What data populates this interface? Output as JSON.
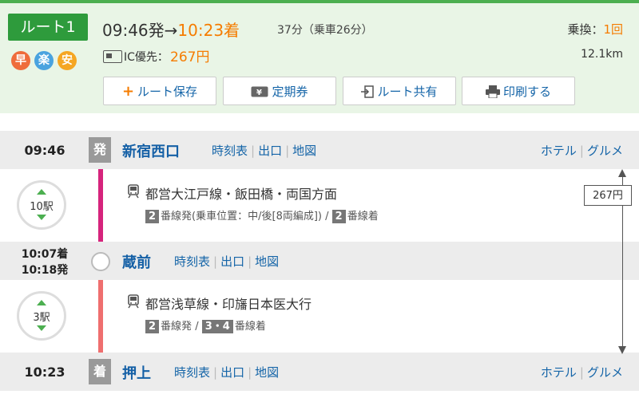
{
  "route": {
    "badge": "ルート1",
    "tags": [
      {
        "label": "早",
        "color": "#ef6c3c"
      },
      {
        "label": "楽",
        "color": "#4aa3df"
      },
      {
        "label": "安",
        "color": "#f5a623"
      }
    ],
    "depart": "09:46発",
    "arrow": "→",
    "arrive": "10:23着",
    "duration": "37分（乗車26分）",
    "transfer_label": "乗換：",
    "transfer_count": "1回",
    "fare_label": "IC優先：",
    "fare_value": "267円",
    "distance": "12.1km"
  },
  "buttons": {
    "save": "ルート保存",
    "pass": "定期券",
    "share": "ルート共有",
    "print": "印刷する"
  },
  "stations": [
    {
      "time": "09:46",
      "badge": "発",
      "name": "新宿西口",
      "links": [
        "時刻表",
        "出口",
        "地図"
      ],
      "extras": [
        "ホテル",
        "グルメ"
      ]
    },
    {
      "time_arr": "10:07着",
      "time_dep": "10:18発",
      "name": "蔵前",
      "links": [
        "時刻表",
        "出口",
        "地図"
      ]
    },
    {
      "time": "10:23",
      "badge": "着",
      "name": "押上",
      "links": [
        "時刻表",
        "出口",
        "地図"
      ],
      "extras": [
        "ホテル",
        "グルメ"
      ]
    }
  ],
  "segments": [
    {
      "stops": "10駅",
      "line": "都営大江戸線・飯田橋・両国方面",
      "platform_parts": [
        "2",
        "番線発(乗車位置：中/後[8両編成])",
        " / ",
        "2",
        "番線着"
      ],
      "color": "#d6247c"
    },
    {
      "stops": "3駅",
      "line": "都営浅草線・印旛日本医大行",
      "platform_parts": [
        "2",
        "番線発",
        " / ",
        "3・4",
        "番線着"
      ],
      "color": "#ef6f6f"
    }
  ],
  "side_fare": "267円",
  "colors": {
    "accent": "#2e9b3c",
    "highlight": "#f57c00",
    "link": "#1565a8"
  }
}
